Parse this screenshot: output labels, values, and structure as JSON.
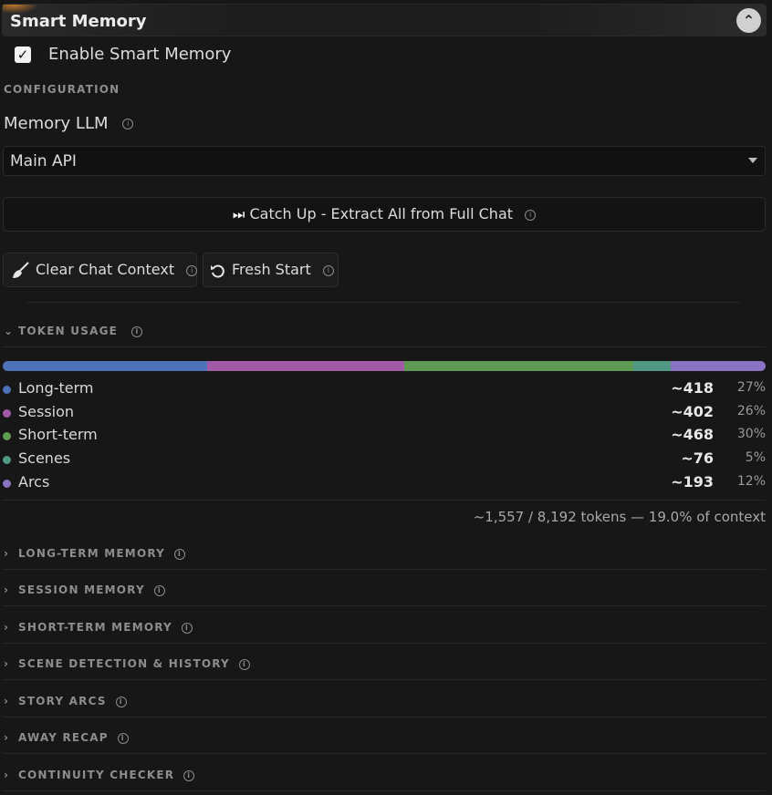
{
  "header": {
    "title": "Smart Memory",
    "collapse_icon": "chevron-up-icon"
  },
  "enable": {
    "label": "Enable Smart Memory",
    "checked": true
  },
  "configuration": {
    "section_label": "CONFIGURATION",
    "memory_llm_label": "Memory LLM",
    "memory_llm_value": "Main API"
  },
  "buttons": {
    "catch_up": "Catch Up - Extract All from Full Chat",
    "clear_chat": "Clear Chat Context",
    "fresh_start": "Fresh Start"
  },
  "token_usage": {
    "title": "TOKEN USAGE",
    "items": [
      {
        "label": "Long-term",
        "value": "~418",
        "pct": "27%",
        "color": "#4e72b8",
        "share": 26.8
      },
      {
        "label": "Session",
        "value": "~402",
        "pct": "26%",
        "color": "#a35aa6",
        "share": 25.8
      },
      {
        "label": "Short-term",
        "value": "~468",
        "pct": "30%",
        "color": "#5f9a55",
        "share": 30.1
      },
      {
        "label": "Scenes",
        "value": "~76",
        "pct": "5%",
        "color": "#4f9882",
        "share": 4.9
      },
      {
        "label": "Arcs",
        "value": "~193",
        "pct": "12%",
        "color": "#8a73c2",
        "share": 12.4
      }
    ],
    "total": "~1,557 / 8,192 tokens — 19.0% of context"
  },
  "sections": [
    {
      "title": "LONG-TERM MEMORY"
    },
    {
      "title": "SESSION MEMORY"
    },
    {
      "title": "SHORT-TERM MEMORY"
    },
    {
      "title": "SCENE DETECTION & HISTORY"
    },
    {
      "title": "STORY ARCS"
    },
    {
      "title": "AWAY RECAP"
    },
    {
      "title": "CONTINUITY CHECKER"
    }
  ]
}
